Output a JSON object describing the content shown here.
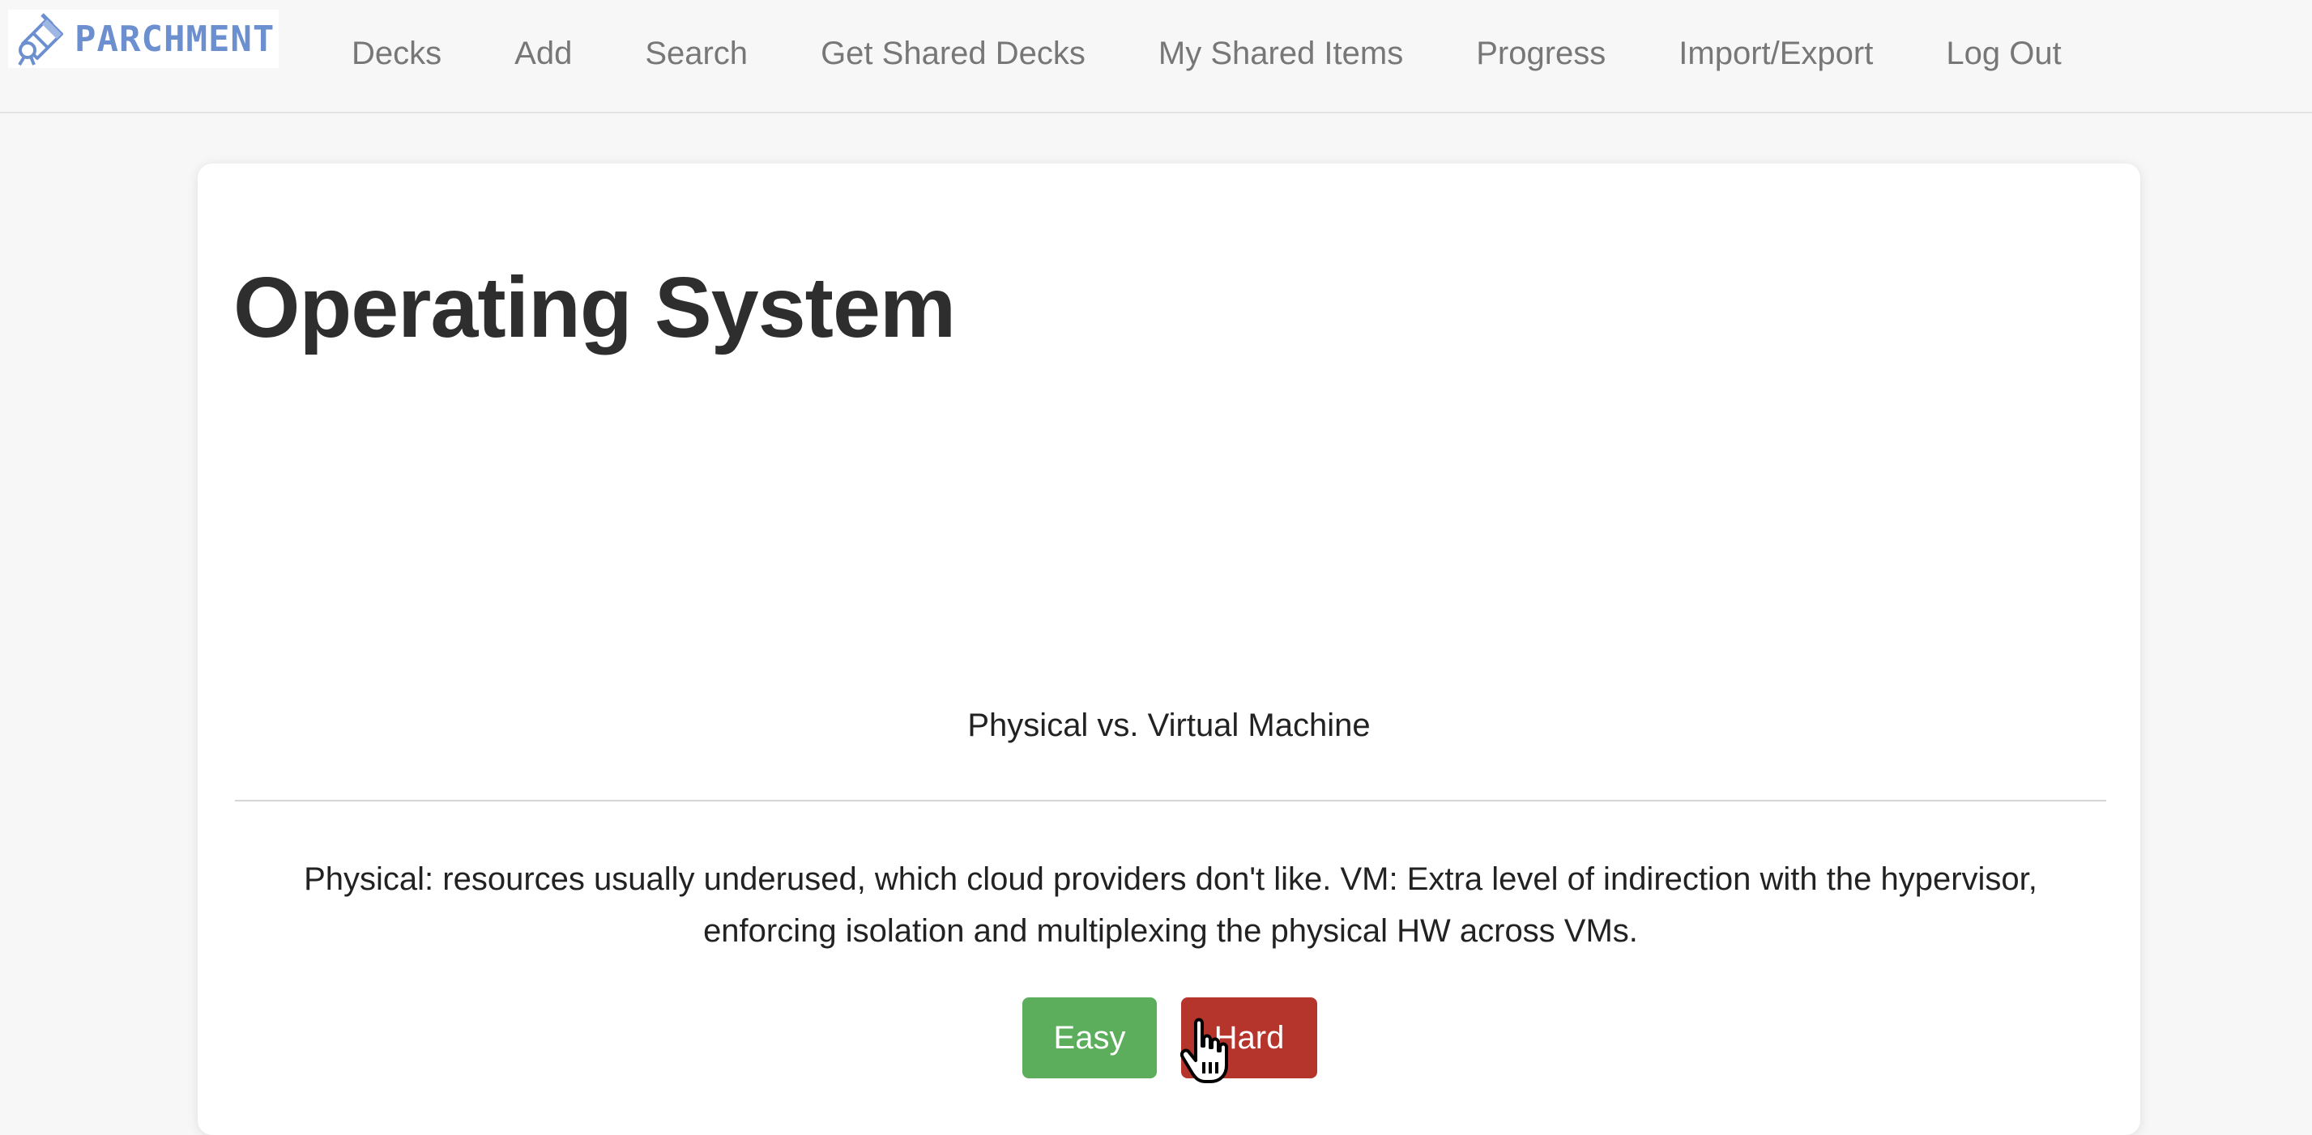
{
  "brand": {
    "name": "PARCHMENT",
    "accent_color": "#6c8fd0"
  },
  "nav": {
    "items": [
      {
        "label": "Decks"
      },
      {
        "label": "Add"
      },
      {
        "label": "Search"
      },
      {
        "label": "Get Shared Decks"
      },
      {
        "label": "My Shared Items"
      },
      {
        "label": "Progress"
      },
      {
        "label": "Import/Export"
      },
      {
        "label": "Log Out"
      }
    ]
  },
  "card": {
    "deck_title": "Operating System",
    "question": "Physical vs. Virtual Machine",
    "answer": "Physical: resources usually underused, which cloud providers don't like. VM: Extra level of indirection with the hypervisor, enforcing isolation and multiplexing the physical HW across VMs."
  },
  "buttons": {
    "easy_label": "Easy",
    "hard_label": "Hard",
    "easy_color": "#5cad5c",
    "hard_color": "#b5342c"
  },
  "cursor": {
    "icon": "hand-pointer-icon"
  }
}
